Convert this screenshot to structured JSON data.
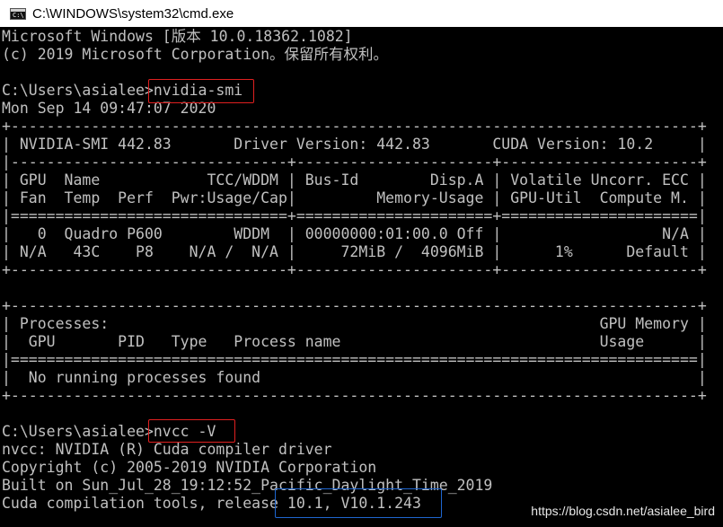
{
  "window": {
    "title": "C:\\WINDOWS\\system32\\cmd.exe",
    "icon": "cmd-icon",
    "icon_text": "C:\\"
  },
  "console": {
    "lines": [
      "Microsoft Windows [版本 10.0.18362.1082]",
      "(c) 2019 Microsoft Corporation。保留所有权利。",
      "",
      "C:\\Users\\asialee>nvidia-smi",
      "Mon Sep 14 09:47:07 2020",
      "+-----------------------------------------------------------------------------+",
      "| NVIDIA-SMI 442.83       Driver Version: 442.83       CUDA Version: 10.2     |",
      "|-------------------------------+----------------------+----------------------+",
      "| GPU  Name            TCC/WDDM | Bus-Id        Disp.A | Volatile Uncorr. ECC |",
      "| Fan  Temp  Perf  Pwr:Usage/Cap|         Memory-Usage | GPU-Util  Compute M. |",
      "|===============================+======================+======================|",
      "|   0  Quadro P600        WDDM  | 00000000:01:00.0 Off |                  N/A |",
      "| N/A   43C    P8    N/A /  N/A |     72MiB /  4096MiB |      1%      Default |",
      "+-------------------------------+----------------------+----------------------+",
      "",
      "+-----------------------------------------------------------------------------+",
      "| Processes:                                                       GPU Memory |",
      "|  GPU       PID   Type   Process name                             Usage      |",
      "|=============================================================================|",
      "|  No running processes found                                                 |",
      "+-----------------------------------------------------------------------------+",
      "",
      "C:\\Users\\asialee>nvcc -V",
      "nvcc: NVIDIA (R) Cuda compiler driver",
      "Copyright (c) 2005-2019 NVIDIA Corporation",
      "Built on Sun_Jul_28_19:12:52_Pacific_Daylight_Time_2019",
      "Cuda compilation tools, release 10.1, V10.1.243"
    ]
  },
  "watermark": "https://blog.csdn.net/asialee_bird",
  "colors": {
    "background": "#000000",
    "text": "#c0c0c0",
    "highlight_red": "#e02020",
    "highlight_blue": "#1e66d0"
  }
}
